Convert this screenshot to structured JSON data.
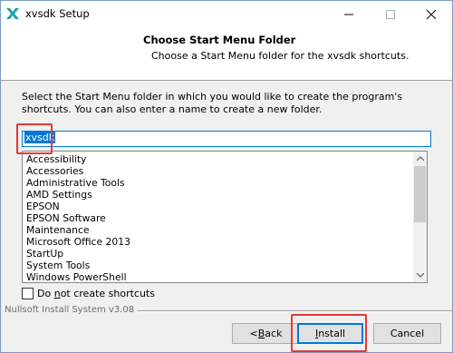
{
  "window": {
    "title": "xvsdk Setup",
    "icon": "nsis-installer-icon"
  },
  "header": {
    "title": "Choose Start Menu Folder",
    "subtitle": "Choose a Start Menu folder for the xvsdk shortcuts."
  },
  "body": {
    "instruction": "Select the Start Menu folder in which you would like to create the program's shortcuts. You can also enter a name to create a new folder.",
    "folder_value": "xvsdk",
    "folders": [
      "Accessibility",
      "Accessories",
      "Administrative Tools",
      "AMD Settings",
      "EPSON",
      "EPSON Software",
      "Maintenance",
      "Microsoft Office 2013",
      "StartUp",
      "System Tools",
      "Windows PowerShell"
    ],
    "checkbox_label": "Do not create shortcuts"
  },
  "footer": {
    "brand": "Nullsoft Install System v3.08",
    "back_label": "< Back",
    "install_label": "Install",
    "cancel_label": "Cancel"
  },
  "colors": {
    "highlight": "#e53935",
    "accent": "#0078d7"
  }
}
